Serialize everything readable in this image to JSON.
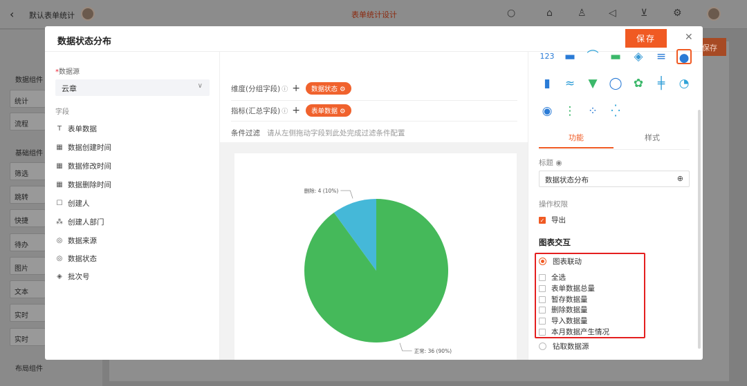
{
  "app": {
    "back_icon": "chevron-left-icon",
    "title": "默认表单统计",
    "center_title": "表单统计设计",
    "bg_save_label": "保存"
  },
  "bg_sidebar": {
    "groups": [
      "数据组件",
      "基础组件",
      "布局组件"
    ],
    "items": [
      "统计",
      "流程",
      "筛选",
      "跳转",
      "快捷",
      "待办",
      "图片",
      "文本",
      "实时",
      "实时"
    ]
  },
  "modal": {
    "title": "数据状态分布",
    "save_label": "保存",
    "close_icon": "close-icon"
  },
  "left": {
    "datasource_label": "数据源",
    "datasource_required_mark": "*",
    "datasource_value": "云章",
    "fields_label": "字段",
    "fields": [
      {
        "label": "表单数据",
        "icon": "text-icon"
      },
      {
        "label": "数据创建时间",
        "icon": "calendar-icon"
      },
      {
        "label": "数据修改时间",
        "icon": "calendar-icon"
      },
      {
        "label": "数据删除时间",
        "icon": "calendar-icon"
      },
      {
        "label": "创建人",
        "icon": "user-icon"
      },
      {
        "label": "创建人部门",
        "icon": "org-icon"
      },
      {
        "label": "数据来源",
        "icon": "source-icon"
      },
      {
        "label": "数据状态",
        "icon": "status-icon"
      },
      {
        "label": "批次号",
        "icon": "layers-icon"
      }
    ]
  },
  "center": {
    "dimension_label": "维度(分组字段)",
    "dimension_tag": "数据状态",
    "metric_label": "指标(汇总字段)",
    "metric_tag": "表单数据",
    "filter_label": "条件过滤",
    "filter_hint": "请从左侧拖动字段到此处完成过滤条件配置"
  },
  "chart_data": {
    "type": "pie",
    "categories": [
      "正常",
      "删除"
    ],
    "values": [
      36,
      4
    ],
    "percentages": [
      90,
      10
    ],
    "labels": [
      "正常: 36 (90%)",
      "删除: 4 (10%)"
    ],
    "colors": [
      "#45b95a",
      "#45b8d8"
    ],
    "title": "",
    "legend": "none"
  },
  "right": {
    "tab_function": "功能",
    "tab_style": "样式",
    "title_label": "标题",
    "title_value": "数据状态分布",
    "permission_label": "操作权限",
    "export_label": "导出",
    "export_checked": true,
    "interaction_title": "图表交互",
    "linkage_label": "图表联动",
    "linkage_selected": true,
    "linkage_options": [
      "全选",
      "表单数据总量",
      "暂存数据量",
      "删除数据量",
      "导入数据量",
      "本月数据产生情况"
    ],
    "drill_label": "钻取数据源",
    "chart_type_icons": [
      {
        "name": "number-card-icon",
        "glyph": "123",
        "color": "#2a7bd6"
      },
      {
        "name": "area-chart-icon",
        "glyph": "▬",
        "color": "#2a7bd6"
      },
      {
        "name": "line-chart-icon",
        "glyph": "⌒",
        "color": "#2fa3d8"
      },
      {
        "name": "bar-flat-icon",
        "glyph": "▬",
        "color": "#3bb86a"
      },
      {
        "name": "map-icon",
        "glyph": "◈",
        "color": "#3a9bd6"
      },
      {
        "name": "hbar-icon",
        "glyph": "≡",
        "color": "#2a7bd6"
      },
      {
        "name": "pie-chart-icon",
        "glyph": "●",
        "color": "#2a7bd6"
      },
      {
        "name": "column-chart-icon",
        "glyph": "▮",
        "color": "#2a7bd6"
      },
      {
        "name": "wave-chart-icon",
        "glyph": "≈",
        "color": "#2a9bd6"
      },
      {
        "name": "funnel-chart-icon",
        "glyph": "▼",
        "color": "#3bb86a"
      },
      {
        "name": "ring-chart-icon",
        "glyph": "◯",
        "color": "#2a7bd6"
      },
      {
        "name": "rose-chart-icon",
        "glyph": "✿",
        "color": "#3bb86a"
      },
      {
        "name": "bullet-chart-icon",
        "glyph": "╪",
        "color": "#2a9bd6"
      },
      {
        "name": "gauge-chart-icon",
        "glyph": "◔",
        "color": "#2fa3d8"
      },
      {
        "name": "radial-chart-icon",
        "glyph": "◉",
        "color": "#2a7bd6"
      },
      {
        "name": "boxplot-icon",
        "glyph": "⋮",
        "color": "#3bb86a"
      },
      {
        "name": "bubble-chart-icon",
        "glyph": "⁘",
        "color": "#2a7bd6"
      },
      {
        "name": "scatter-chart-icon",
        "glyph": "⁛",
        "color": "#2fa3d8"
      }
    ]
  }
}
